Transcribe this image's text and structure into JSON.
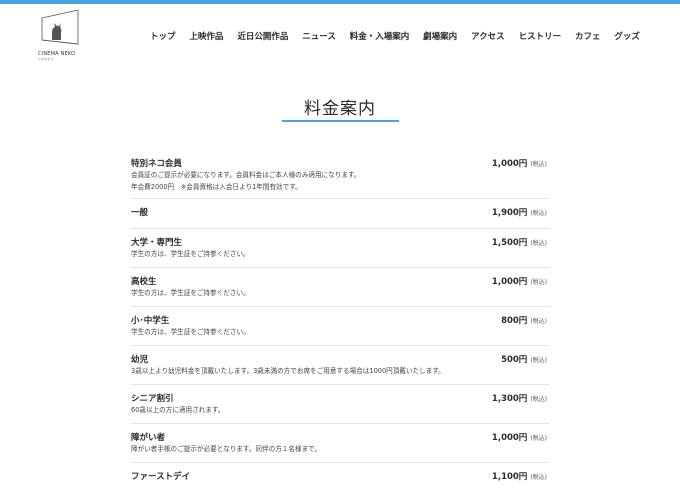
{
  "colors": {
    "accent": "#4aa3df",
    "divider": "#e4e4e4",
    "text": "#2b2b2b"
  },
  "logo": {
    "text": "CINEMA NEKO",
    "sub": "シネマネコ"
  },
  "nav": {
    "items": [
      "トップ",
      "上映作品",
      "近日公開作品",
      "ニュース",
      "料金・入場案内",
      "劇場案内",
      "アクセス",
      "ヒストリー",
      "カフェ",
      "グッズ"
    ]
  },
  "page": {
    "title": "料金案内"
  },
  "prices": [
    {
      "name": "特別ネコ会員",
      "price": "1,000円",
      "tax": "(税込)",
      "desc": [
        "会員証のご提示が必要になります。会員料金はご本人様のみ適用になります。",
        "年会費2000円　※会員資格は入会日より1年間有効です。"
      ]
    },
    {
      "name": "一般",
      "price": "1,900円",
      "tax": "(税込)",
      "desc": []
    },
    {
      "name": "大学・専門生",
      "price": "1,500円",
      "tax": "(税込)",
      "desc": [
        "学生の方は、学生証をご持参ください。"
      ]
    },
    {
      "name": "高校生",
      "price": "1,000円",
      "tax": "(税込)",
      "desc": [
        "学生の方は、学生証をご持参ください。"
      ]
    },
    {
      "name": "小･中学生",
      "price": "800円",
      "tax": "(税込)",
      "desc": [
        "学生の方は、学生証をご持参ください。"
      ]
    },
    {
      "name": "幼児",
      "price": "500円",
      "tax": "(税込)",
      "desc": [
        "3歳以上より幼児料金を頂戴いたします。3歳未満の方でお席をご用意する場合は1000円頂戴いたします。"
      ]
    },
    {
      "name": "シニア割引",
      "price": "1,300円",
      "tax": "(税込)",
      "desc": [
        "60歳以上の方に適用されます。"
      ]
    },
    {
      "name": "障がい者",
      "price": "1,000円",
      "tax": "(税込)",
      "desc": [
        "障がい者手帳のご提示が必要となります。同伴の方１名様まで。"
      ]
    },
    {
      "name": "ファーストデイ",
      "price": "1,100円",
      "tax": "(税込)",
      "desc": []
    }
  ]
}
